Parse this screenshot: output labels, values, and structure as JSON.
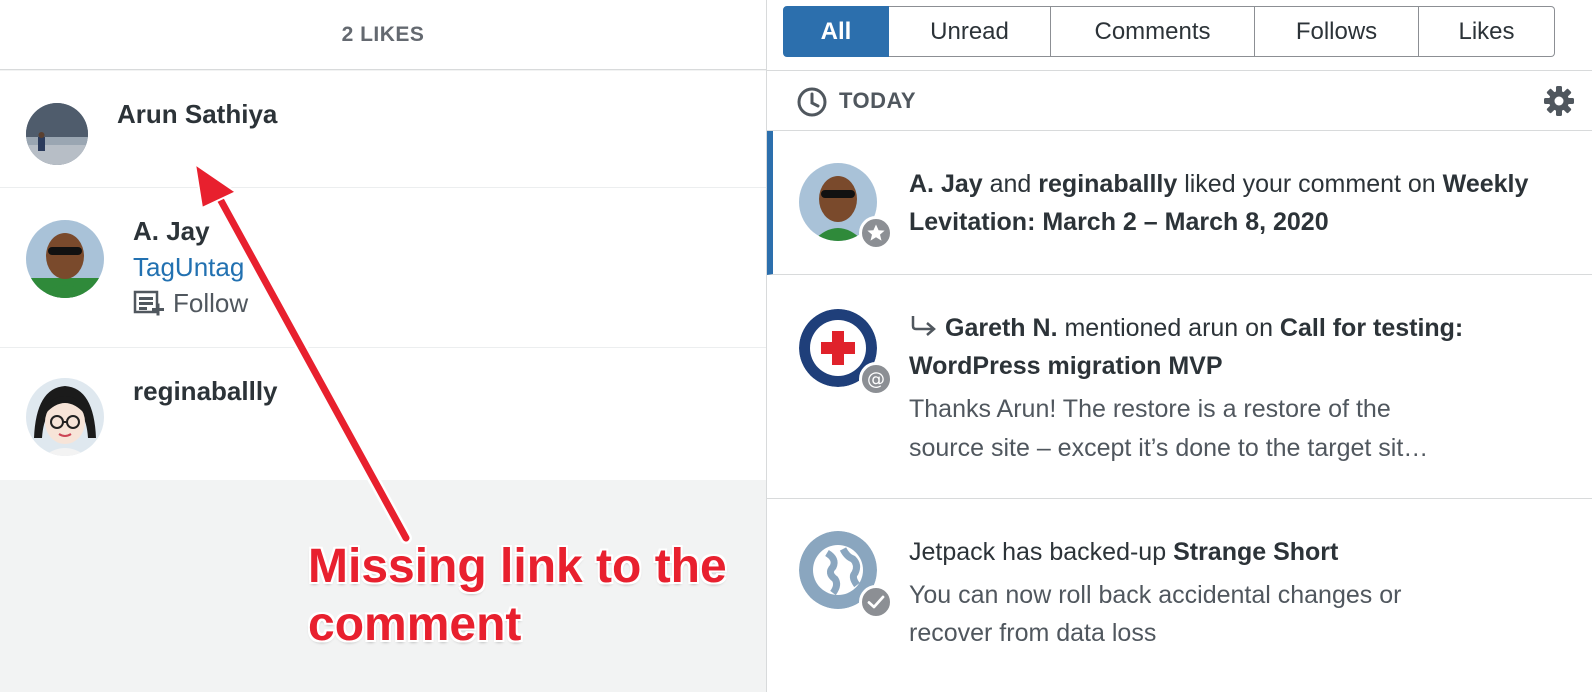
{
  "likes_panel": {
    "header": "2 LIKES",
    "rows": [
      {
        "name": "Arun Sathiya"
      },
      {
        "name": "A. Jay",
        "site": "TagUntag",
        "follow_label": "Follow"
      },
      {
        "name": "reginaballly"
      }
    ]
  },
  "notifications": {
    "tabs": [
      "All",
      "Unread",
      "Comments",
      "Follows",
      "Likes"
    ],
    "active_tab": "All",
    "section_label": "TODAY",
    "items": [
      {
        "actor1": "A. Jay",
        "joiner": "and",
        "actor2": "reginaballly",
        "action": "liked your comment on",
        "post": "Weekly Levitation: March 2 – March 8, 2020",
        "badge_icon": "star-icon"
      },
      {
        "actor": "Gareth N.",
        "action": "mentioned arun on",
        "post": "Call for testing: WordPress migration MVP",
        "excerpt_line1": "Thanks Arun! The restore is a restore of the",
        "excerpt_line2": "source site – except it’s done to the target sit…",
        "badge_icon": "at-icon"
      },
      {
        "prefix": "Jetpack has backed-up",
        "site": "Strange Short",
        "body_line1": "You can now roll back accidental changes or",
        "body_line2": "recover from data loss",
        "badge_icon": "check-icon"
      }
    ]
  },
  "annotation": {
    "line1": "Missing link to the",
    "line2": "comment",
    "color": "#e8202e"
  },
  "colors": {
    "accent": "#2c6fad",
    "link": "#2271b1"
  }
}
